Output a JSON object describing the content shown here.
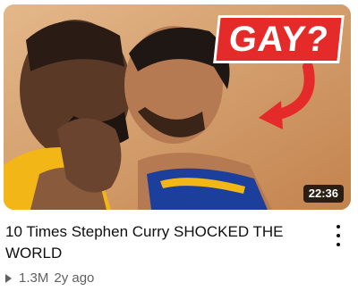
{
  "video": {
    "overlay_text": "GAY?",
    "duration": "22:36",
    "title": "10 Times Stephen Curry SHOCKED THE WORLD",
    "views": "1.3M",
    "age": "2y ago"
  },
  "icons": {
    "more": "more-vert-icon",
    "views": "play-outline-icon"
  },
  "colors": {
    "overlay_bg": "#e52a2a",
    "arrow": "#e52a2a",
    "jersey_yellow": "#f2b616",
    "jersey_blue": "#1d3f9c",
    "background_warm": "#d8a874"
  }
}
